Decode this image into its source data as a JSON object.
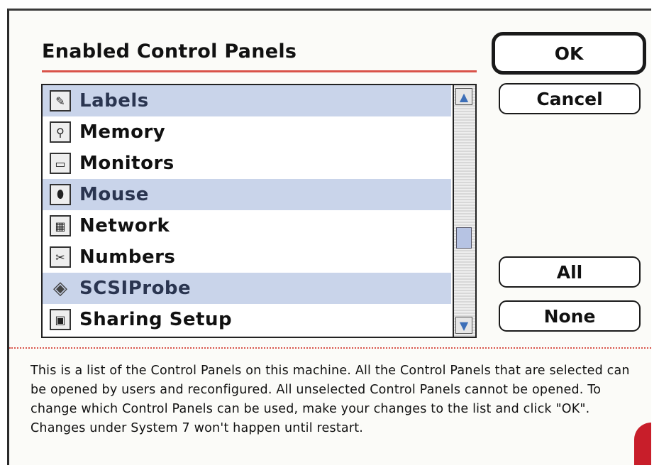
{
  "dialog": {
    "title": "Enabled Control Panels",
    "description": "This is a list of the Control Panels on this machine. All the Control Panels that are selected can be opened by users and reconfigured. All unselected Control Panels cannot be opened. To change which Control Panels can be used, make your changes to the list and click \"OK\". Changes under System 7 won't happen until restart."
  },
  "list": {
    "items": [
      {
        "label": "Labels",
        "selected": true,
        "icon": "labels-icon"
      },
      {
        "label": "Memory",
        "selected": false,
        "icon": "memory-icon"
      },
      {
        "label": "Monitors",
        "selected": false,
        "icon": "monitors-icon"
      },
      {
        "label": "Mouse",
        "selected": true,
        "icon": "mouse-icon"
      },
      {
        "label": "Network",
        "selected": false,
        "icon": "network-icon"
      },
      {
        "label": "Numbers",
        "selected": false,
        "icon": "numbers-icon"
      },
      {
        "label": "SCSIProbe",
        "selected": true,
        "icon": "scsiprobe-icon"
      },
      {
        "label": "Sharing Setup",
        "selected": false,
        "icon": "sharing-setup-icon"
      }
    ]
  },
  "buttons": {
    "ok": "OK",
    "cancel": "Cancel",
    "all": "All",
    "none": "None"
  },
  "colors": {
    "selection": "#c9d4ea",
    "accent_rule": "#d9534a"
  }
}
